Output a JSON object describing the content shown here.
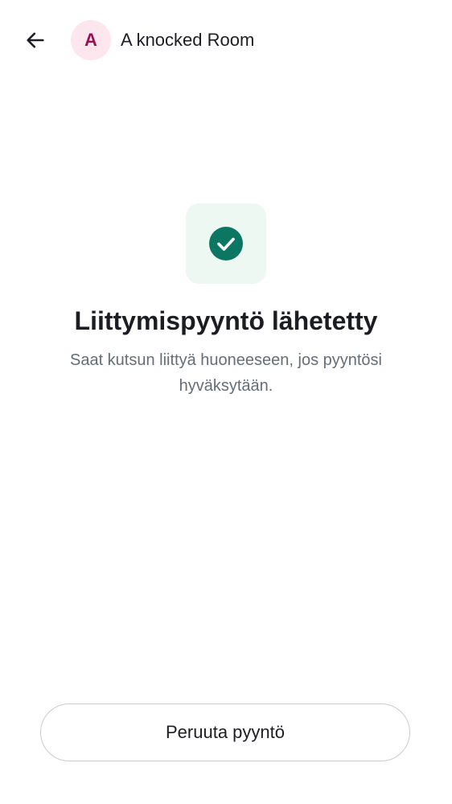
{
  "header": {
    "back_icon": "arrow-left-icon",
    "room_avatar_letter": "A",
    "room_name": "A knocked Room"
  },
  "status": {
    "icon": "check-circle-icon",
    "title": "Liittymispyyntö lähetetty",
    "message": "Saat kutsun liittyä huoneeseen, jos pyyntösi hyväksytään."
  },
  "actions": {
    "cancel_label": "Peruuta pyyntö"
  },
  "colors": {
    "accent": "#0b7661",
    "tile_background": "#eef8f3",
    "avatar_background": "#fde6ee",
    "avatar_text": "#9b1050"
  }
}
